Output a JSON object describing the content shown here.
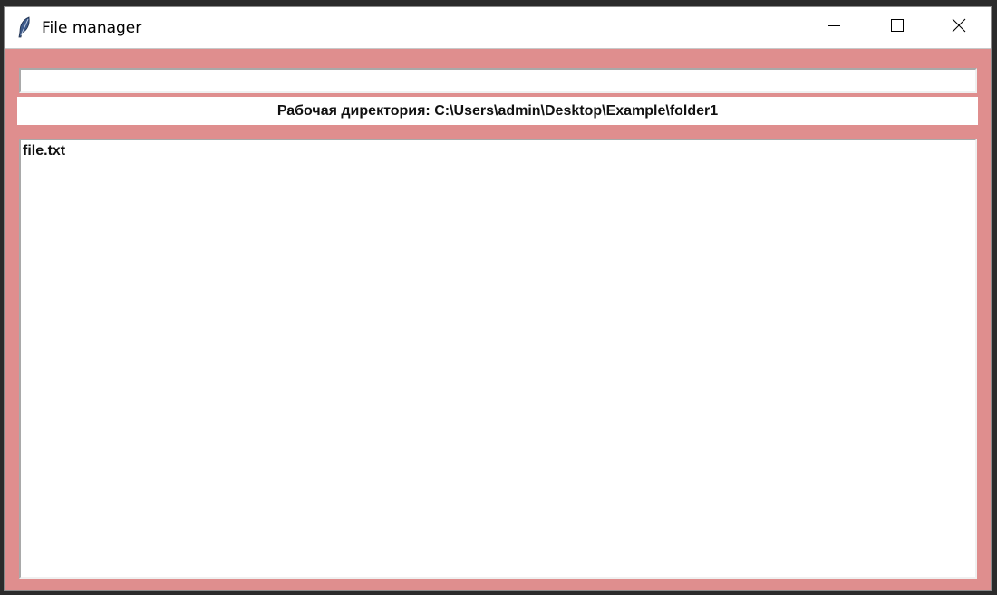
{
  "window": {
    "title": "File manager",
    "icon": "feather-icon",
    "controls": {
      "minimize_icon": "minimize-icon",
      "maximize_icon": "maximize-icon",
      "close_icon": "close-icon"
    }
  },
  "path_input": {
    "value": "",
    "placeholder": ""
  },
  "working_dir": {
    "text": "Рабочая директория: C:\\Users\\admin\\Desktop\\Example\\folder1"
  },
  "files": [
    {
      "name": "file.txt"
    }
  ],
  "colors": {
    "client_background": "#df8e8e",
    "panel_background": "#ffffff",
    "text": "#111111"
  }
}
